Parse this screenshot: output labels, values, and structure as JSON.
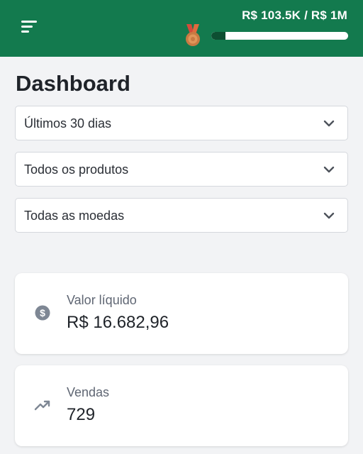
{
  "header": {
    "menu_icon": "menu-icon",
    "medal_icon": "bronze-medal-icon",
    "goal_text": "R$ 103.5K / R$ 1M",
    "goal_progress": 0.1035,
    "colors": {
      "bar": "#137a4e",
      "progress_fill": "#0d4f32",
      "track": "#ffffff"
    }
  },
  "page": {
    "title": "Dashboard"
  },
  "filters": [
    {
      "value": "Últimos 30 dias",
      "icon": "chevron-down-icon"
    },
    {
      "value": "Todos os produtos",
      "icon": "chevron-down-icon"
    },
    {
      "value": "Todas as moedas",
      "icon": "chevron-down-icon"
    }
  ],
  "cards": [
    {
      "icon": "dollar-circle-icon",
      "label": "Valor líquido",
      "value": "R$ 16.682,96"
    },
    {
      "icon": "trending-up-icon",
      "label": "Vendas",
      "value": "729"
    }
  ]
}
